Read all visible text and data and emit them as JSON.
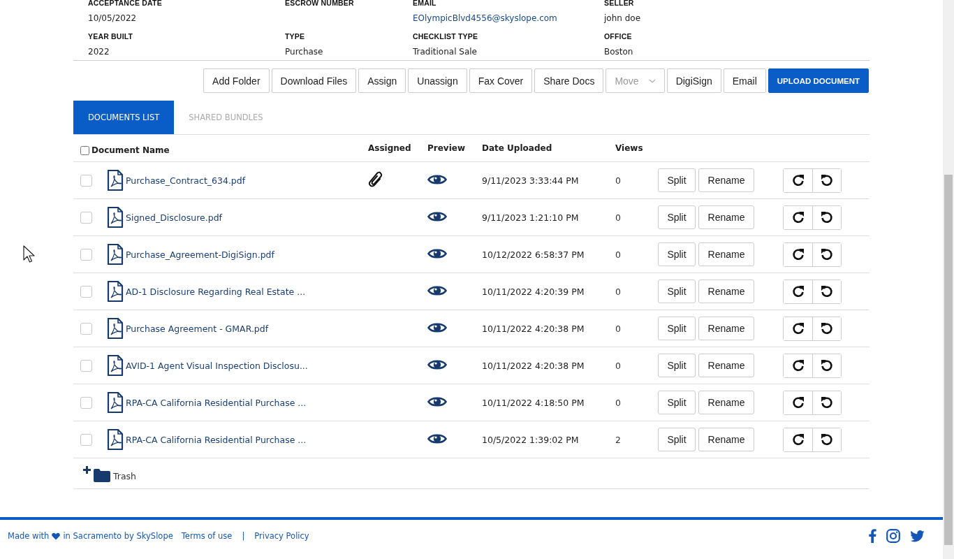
{
  "details": [
    {
      "label": "ACCEPTANCE DATE",
      "value": "10/05/2022",
      "kind": "text"
    },
    {
      "label": "ESCROW NUMBER"
    },
    {
      "label": "EMAIL",
      "value": "EOlympicBlvd4556@skyslope.com",
      "kind": "link"
    },
    {
      "label": "SELLER",
      "value": "john doe",
      "kind": "text"
    },
    {
      "label": "YEAR BUILT",
      "value": "2022",
      "kind": "text"
    },
    {
      "label": "TYPE",
      "value": "Purchase",
      "kind": "text"
    },
    {
      "label": "CHECKLIST TYPE",
      "value": "Traditional Sale",
      "kind": "text"
    },
    {
      "label": "OFFICE",
      "value": "Boston",
      "kind": "text"
    }
  ],
  "toolbar": [
    {
      "label": "Add Folder",
      "kind": "default",
      "disabled": false
    },
    {
      "label": "Download Files",
      "kind": "default",
      "disabled": false
    },
    {
      "label": "Assign",
      "kind": "default",
      "disabled": false
    },
    {
      "label": "Unassign",
      "kind": "default",
      "disabled": false
    },
    {
      "label": "Fax Cover",
      "kind": "default",
      "disabled": false
    },
    {
      "label": "Share Docs",
      "kind": "default",
      "disabled": false
    },
    {
      "label": "Move",
      "kind": "dropdown",
      "disabled": true
    },
    {
      "label": "DigiSign",
      "kind": "default",
      "disabled": false
    },
    {
      "label": "Email",
      "kind": "default",
      "disabled": false
    },
    {
      "label": "UPLOAD DOCUMENT",
      "kind": "primary",
      "disabled": false
    }
  ],
  "tabs": [
    {
      "label": "DOCUMENTS LIST",
      "selected": true
    },
    {
      "label": "SHARED BUNDLES",
      "selected": false
    }
  ],
  "table": {
    "select_all": {
      "checked": false
    },
    "columns": [
      "Document Name",
      "Assigned",
      "Preview",
      "Date Uploaded",
      "Views"
    ],
    "rows": [
      {
        "checked": false,
        "name": "Purchase_Contract_634.pdf",
        "assigned": true,
        "date": "9/11/2023 3:33:44 PM",
        "views": "0",
        "split": "Split",
        "rename": "Rename"
      },
      {
        "checked": false,
        "name": "Signed_Disclosure.pdf",
        "assigned": false,
        "date": "9/11/2023 1:21:10 PM",
        "views": "0",
        "split": "Split",
        "rename": "Rename"
      },
      {
        "checked": false,
        "name": "Purchase_Agreement-DigiSign.pdf",
        "assigned": false,
        "date": "10/12/2022 6:58:37 PM",
        "views": "0",
        "split": "Split",
        "rename": "Rename"
      },
      {
        "checked": false,
        "name": "AD-1 Disclosure Regarding Real Estate ...",
        "assigned": false,
        "date": "10/11/2022 4:20:39 PM",
        "views": "0",
        "split": "Split",
        "rename": "Rename"
      },
      {
        "checked": false,
        "name": "Purchase Agreement - GMAR.pdf",
        "assigned": false,
        "date": "10/11/2022 4:20:38 PM",
        "views": "0",
        "split": "Split",
        "rename": "Rename"
      },
      {
        "checked": false,
        "name": "AVID-1 Agent Visual Inspection Disclosu...",
        "assigned": false,
        "date": "10/11/2022 4:20:38 PM",
        "views": "0",
        "split": "Split",
        "rename": "Rename"
      },
      {
        "checked": false,
        "name": "RPA-CA California Residential Purchase ...",
        "assigned": false,
        "date": "10/11/2022 4:18:50 PM",
        "views": "0",
        "split": "Split",
        "rename": "Rename"
      },
      {
        "checked": false,
        "name": "RPA-CA California Residential Purchase ...",
        "assigned": false,
        "date": "10/5/2022 1:39:02 PM",
        "views": "2",
        "split": "Split",
        "rename": "Rename"
      }
    ]
  },
  "trash": {
    "label": "Trash",
    "expanded": false
  },
  "footer": {
    "credit_before": "Made with",
    "credit_after": "in Sacramento by SkySlope",
    "links": [
      "Terms of use",
      "Privacy Policy"
    ],
    "separator": "|"
  }
}
